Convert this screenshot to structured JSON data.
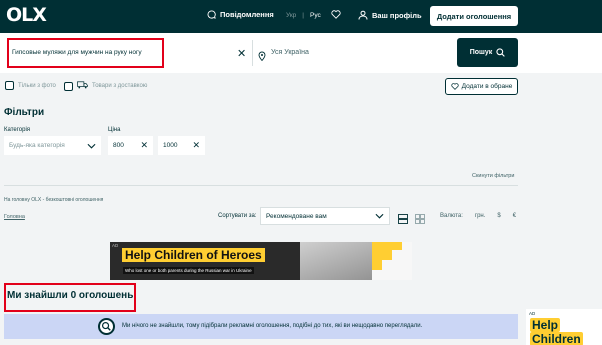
{
  "header": {
    "logo": "OLX",
    "messages_label": "Повідомлення",
    "lang_ukr": "Укр",
    "lang_rus": "Рус",
    "profile_label": "Ваш профіль",
    "post_ad_label": "Додати оголошення"
  },
  "search": {
    "query": "Гипсовые муляжи для мужчин на руку ногу",
    "location_placeholder": "Уся Україна",
    "search_button": "Пошук"
  },
  "options": {
    "photo_only": "Тільки з фото",
    "with_delivery": "Товари з доставкою",
    "add_favorites": "Додати в обране"
  },
  "filters": {
    "title": "Фільтри",
    "category_label": "Категорія",
    "category_value": "Будь-яка категорія",
    "price_label": "Ціна",
    "price_min": "800",
    "price_max": "1000",
    "reset": "Скинути фільтри"
  },
  "listing": {
    "info": "На головну OLX - безкоштовні оголошення",
    "home_link": "Головна",
    "sort_label": "Сортувати за:",
    "sort_value": "Рекомендоване вам",
    "currency_label": "Валюта:",
    "currencies": [
      "грн.",
      "$",
      "€"
    ]
  },
  "ad_banner": {
    "tag": "AD",
    "title": "Help Children of Heroes",
    "subtitle": "Who lost one or both parents during the Russian war in Ukraine"
  },
  "results": {
    "title": "Ми знайшли 0 оголошень",
    "notice": "Ми нічого не знайшли, тому підібрали рекламні оголошення, подібні до тих, які ви нещодавно переглядали."
  },
  "side_ad": {
    "tag": "AD",
    "line1": "Help",
    "line2": "Children"
  },
  "colors": {
    "brand_dark": "#002f34",
    "highlight_red": "#e2001a",
    "notice_blue": "#cbd6f5",
    "ad_yellow": "#ffce32"
  }
}
